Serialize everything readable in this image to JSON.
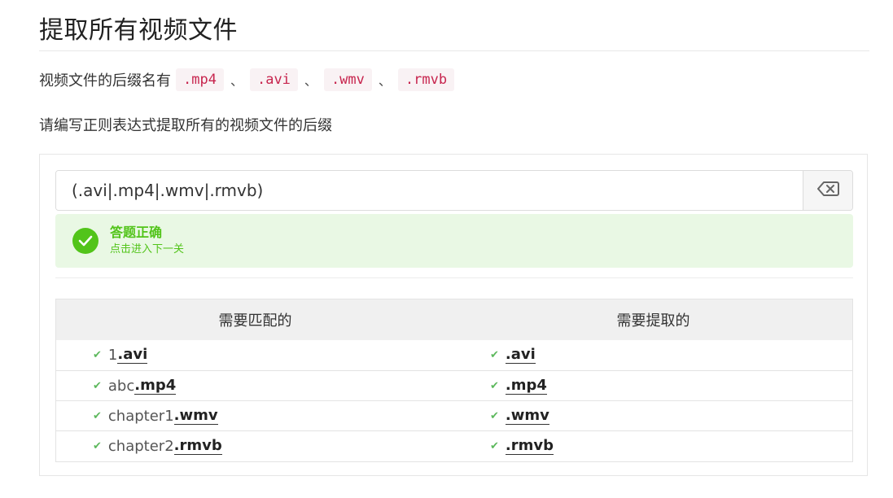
{
  "header": {
    "title": "提取所有视频文件"
  },
  "description": {
    "prefix": "视频文件的后缀名有",
    "extensions": [
      ".mp4",
      ".avi",
      ".wmv",
      ".rmvb"
    ],
    "separator": "、"
  },
  "instruction": "请编写正则表达式提取所有的视频文件的后缀",
  "answer": {
    "value": "(.avi|.mp4|.wmv|.rmvb)",
    "clear_icon": "backspace-icon"
  },
  "result": {
    "status": "correct",
    "title": "答题正确",
    "subtitle": "点击进入下一关",
    "icon": "check-circle-icon",
    "color": "#52c41a",
    "background": "#e9f8e4"
  },
  "table": {
    "headers": [
      "需要匹配的",
      "需要提取的"
    ],
    "rows": [
      {
        "text_plain": "1",
        "text_match": ".avi",
        "extracted": ".avi"
      },
      {
        "text_plain": "abc",
        "text_match": ".mp4",
        "extracted": ".mp4"
      },
      {
        "text_plain": "chapter1",
        "text_match": ".wmv",
        "extracted": ".wmv"
      },
      {
        "text_plain": "chapter2",
        "text_match": ".rmvb",
        "extracted": ".rmvb"
      }
    ],
    "tick": "✔"
  },
  "colors": {
    "code_text": "#c7254e",
    "code_bg": "#f9f2f4",
    "success": "#52c41a",
    "tick": "#5cb85c"
  }
}
